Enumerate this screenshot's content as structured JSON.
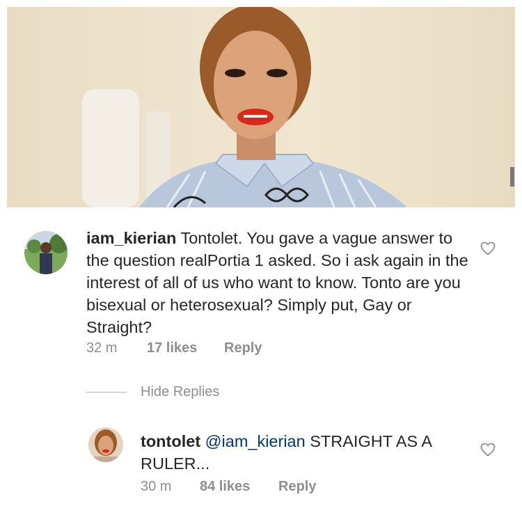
{
  "photo": {
    "alt_subject": "portrait"
  },
  "comment": {
    "username": "iam_kierian",
    "text": "Tontolet. You gave a vague answer to the question realPortia 1 asked. So i ask again in the interest of all of us who want to know. Tonto are you bisexual or heterosexual? Simply put, Gay or Straight?",
    "time": "32 m",
    "likes": "17 likes",
    "reply_label": "Reply"
  },
  "hide_replies_label": "Hide Replies",
  "reply": {
    "username": "tontolet",
    "mention": "@iam_kierian",
    "text": "STRAIGHT AS A RULER...",
    "time": "30 m",
    "likes": "84 likes",
    "reply_label": "Reply"
  },
  "colors": {
    "mention": "#00376b",
    "meta": "#8e8e8e",
    "text": "#262626"
  },
  "icons": {
    "like": "heart-outline-icon"
  }
}
